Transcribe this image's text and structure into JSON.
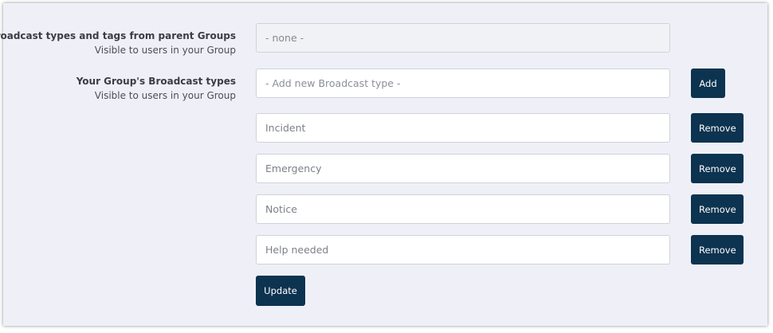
{
  "parent_groups": {
    "label": "Broadcast types and tags from parent Groups",
    "sublabel": "Visible to users in your Group",
    "value": "- none -"
  },
  "own_types": {
    "label": "Your Group's Broadcast types",
    "sublabel": "Visible to users in your Group",
    "new_placeholder": "- Add new Broadcast type -",
    "add_label": "Add",
    "remove_label": "Remove",
    "items": [
      {
        "value": "Incident"
      },
      {
        "value": "Emergency"
      },
      {
        "value": "Notice"
      },
      {
        "value": "Help needed"
      }
    ]
  },
  "update_label": "Update",
  "colors": {
    "panel_bg": "#eff0f7",
    "button_bg": "#0c3350",
    "button_text": "#ffffff"
  }
}
